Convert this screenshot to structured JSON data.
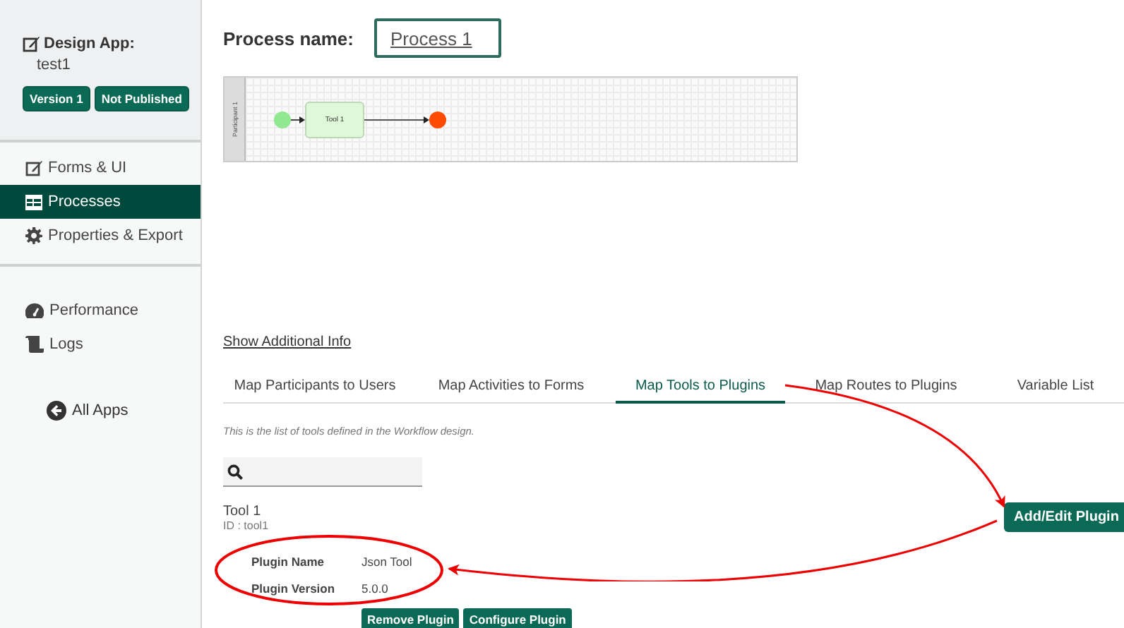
{
  "sidebar": {
    "app_label": "Design App:",
    "app_name": "test1",
    "badges": [
      "Version 1",
      "Not Published"
    ],
    "menu": [
      {
        "label": "Forms & UI",
        "selected": false
      },
      {
        "label": "Processes",
        "selected": true
      },
      {
        "label": "Properties & Export",
        "selected": false
      }
    ],
    "secondary": [
      {
        "label": "Performance"
      },
      {
        "label": "Logs"
      }
    ],
    "all_apps": "All Apps"
  },
  "process_name": {
    "label": "Process name:",
    "value": "Process 1"
  },
  "diagram": {
    "lane": "Participant 1",
    "task": "Tool 1"
  },
  "show_info_link": "Show Additional Info",
  "tabs": [
    {
      "label": "Map Participants to Users",
      "selected": false
    },
    {
      "label": "Map Activities to Forms",
      "selected": false
    },
    {
      "label": "Map Tools to Plugins",
      "selected": true
    },
    {
      "label": "Map Routes to Plugins",
      "selected": false
    },
    {
      "label": "Variable List",
      "selected": false
    }
  ],
  "description": "This is the list of tools defined in the Workflow design.",
  "tool": {
    "name": "Tool 1",
    "id": "ID : tool1",
    "fields": [
      {
        "label": "Plugin Name",
        "value": "Json Tool"
      },
      {
        "label": "Plugin Version",
        "value": "5.0.0"
      }
    ],
    "buttons": [
      "Remove Plugin",
      "Configure Plugin"
    ]
  },
  "add_button": "Add/Edit Plugin"
}
